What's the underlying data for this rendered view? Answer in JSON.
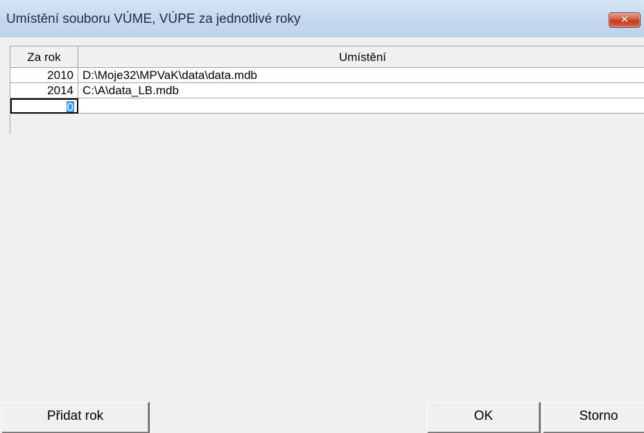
{
  "window": {
    "title": "Umístění souboru VÚME, VÚPE za jednotlivé roky",
    "close_icon": "close-icon",
    "close_symbol": "✕"
  },
  "grid": {
    "columns": [
      "Za rok",
      "Umístění"
    ],
    "rows": [
      {
        "year": "2010",
        "location": "D:\\Moje32\\MPVaK\\data\\data.mdb"
      },
      {
        "year": "2014",
        "location": "C:\\A\\data_LB.mdb"
      },
      {
        "year": "0",
        "location": ""
      }
    ]
  },
  "buttons": {
    "add_year": "Přidat rok",
    "ok": "OK",
    "cancel": "Storno"
  },
  "colors": {
    "selection": "#3399ff",
    "close_button": "#c23a20"
  }
}
